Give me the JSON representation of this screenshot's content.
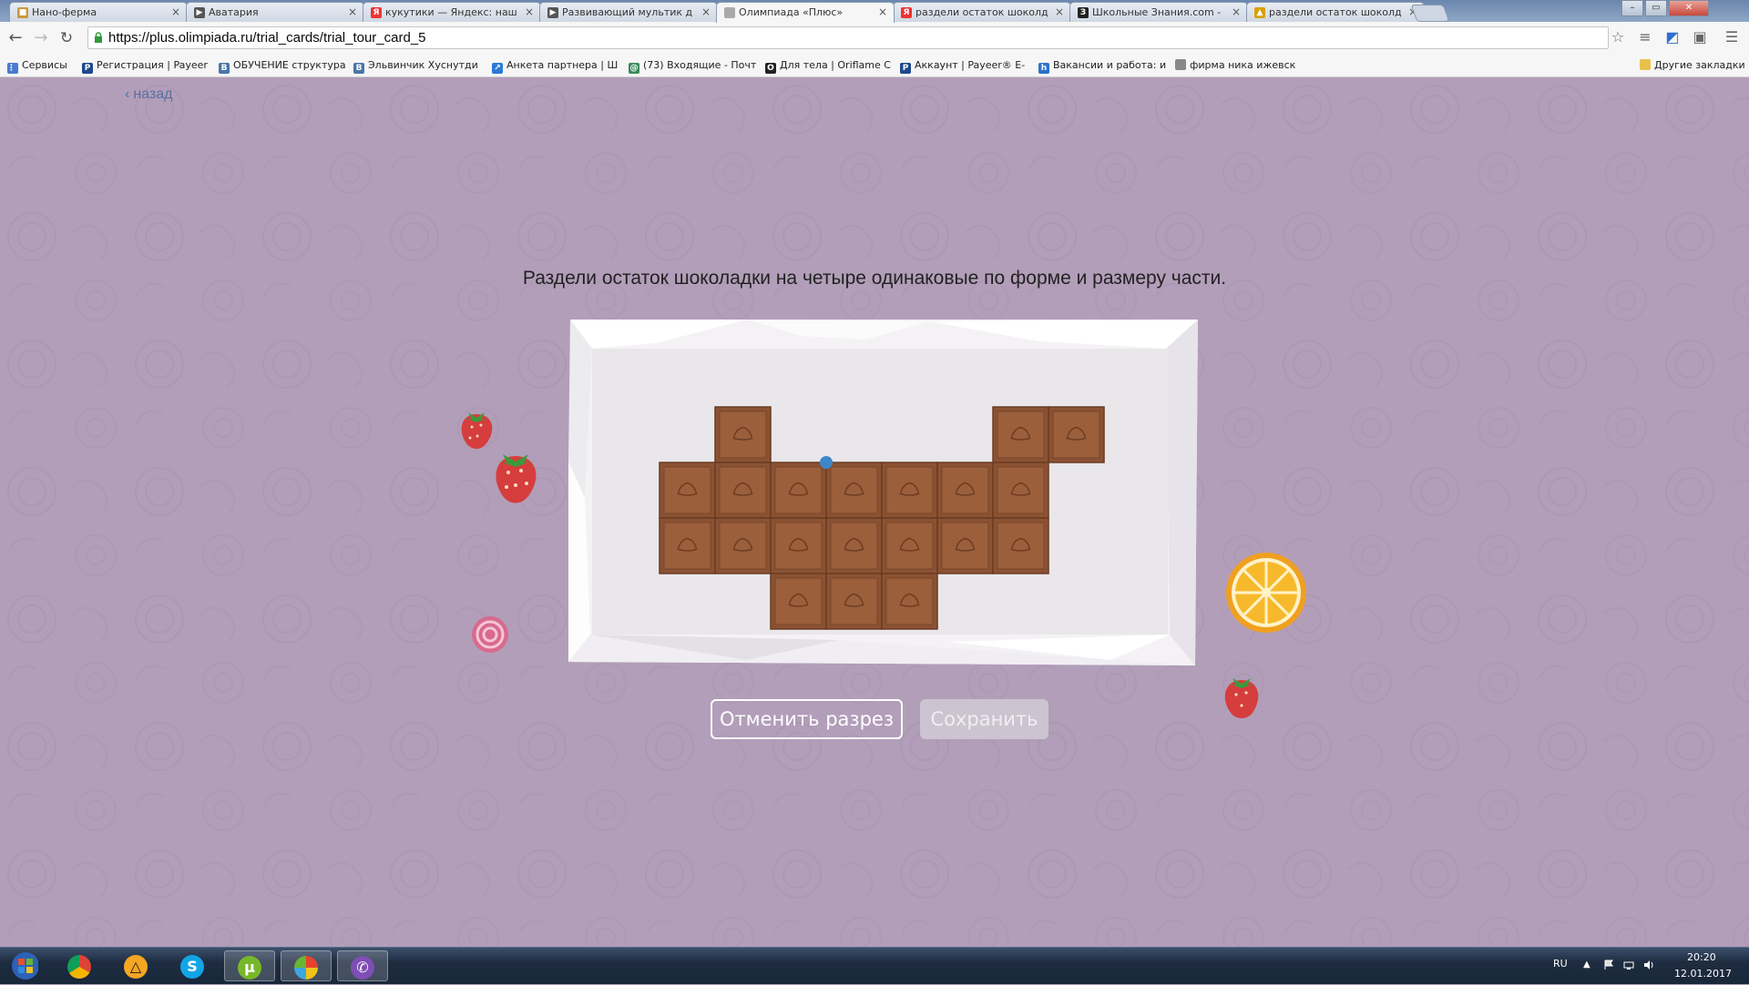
{
  "browser": {
    "tabs": [
      {
        "title": "Нано-ферма",
        "icon": "game-icon",
        "active": false
      },
      {
        "title": "Аватария",
        "icon": "video-icon",
        "active": false
      },
      {
        "title": "кукутики — Яндекс: наш",
        "icon": "yandex-icon",
        "active": false
      },
      {
        "title": "Развивающий мультик д",
        "icon": "video-icon",
        "active": false
      },
      {
        "title": "Олимпиада «Плюс»",
        "icon": "page-icon",
        "active": true
      },
      {
        "title": "раздели остаток шоколд",
        "icon": "yandex-icon",
        "active": false
      },
      {
        "title": "Школьные Знания.com -",
        "icon": "znanija-icon",
        "active": false
      },
      {
        "title": "раздели остаток шоколд",
        "icon": "image-icon",
        "active": false
      }
    ],
    "url": "https://plus.olimpiada.ru/trial_cards/trial_tour_card_5",
    "bookmarks": [
      {
        "label": "Сервисы",
        "icon": "apps-icon"
      },
      {
        "label": "Регистрация | Payeer",
        "icon": "payeer-icon"
      },
      {
        "label": "ОБУЧЕНИЕ структура",
        "icon": "vk-icon"
      },
      {
        "label": "Эльвинчик Хуснутди",
        "icon": "vk-icon"
      },
      {
        "label": "Анкета партнера | Ш",
        "icon": "chart-icon"
      },
      {
        "label": "(73) Входящие - Почт",
        "icon": "mail-icon"
      },
      {
        "label": "Для тела | Oriflame C",
        "icon": "oriflame-icon"
      },
      {
        "label": "Аккаунт | Payeer® E-",
        "icon": "payeer-icon"
      },
      {
        "label": "Вакансии и работа: и",
        "icon": "hh-icon"
      },
      {
        "label": "фирма ника ижевск",
        "icon": "yandex-icon"
      }
    ],
    "other_bookmarks": "Другие закладки"
  },
  "page": {
    "back_label": "назад",
    "task_text": "Раздели остаток шоколадки на четыре одинаковые по форме и размеру части.",
    "cancel_button": "Отменить разрез",
    "save_button": "Сохранить",
    "colors": {
      "background": "#b29eb9",
      "chocolate": "#8a5233",
      "chocolate_light": "#9b5f3c",
      "marker": "#3f86c8"
    },
    "chocolate_pieces": [
      {
        "row": 0,
        "col": 1
      },
      {
        "row": 0,
        "col": 6
      },
      {
        "row": 0,
        "col": 7
      },
      {
        "row": 1,
        "col": 0
      },
      {
        "row": 1,
        "col": 1
      },
      {
        "row": 1,
        "col": 2
      },
      {
        "row": 1,
        "col": 3
      },
      {
        "row": 1,
        "col": 4
      },
      {
        "row": 1,
        "col": 5
      },
      {
        "row": 1,
        "col": 6
      },
      {
        "row": 2,
        "col": 0
      },
      {
        "row": 2,
        "col": 1
      },
      {
        "row": 2,
        "col": 2
      },
      {
        "row": 2,
        "col": 3
      },
      {
        "row": 2,
        "col": 4
      },
      {
        "row": 2,
        "col": 5
      },
      {
        "row": 2,
        "col": 6
      },
      {
        "row": 3,
        "col": 2
      },
      {
        "row": 3,
        "col": 3
      },
      {
        "row": 3,
        "col": 4
      }
    ],
    "cut_marker": {
      "row_line": 1,
      "col_line": 3
    },
    "decorations": [
      "strawberry-icon",
      "strawberry-icon",
      "candy-icon",
      "orange-slice-icon",
      "strawberry-icon"
    ]
  },
  "taskbar": {
    "apps": [
      "start-icon",
      "chrome-icon",
      "avast-icon",
      "skype-icon",
      "utorrent-icon",
      "paint-icon",
      "viber-icon"
    ],
    "lang": "RU",
    "time": "20:20",
    "date": "12.01.2017"
  }
}
